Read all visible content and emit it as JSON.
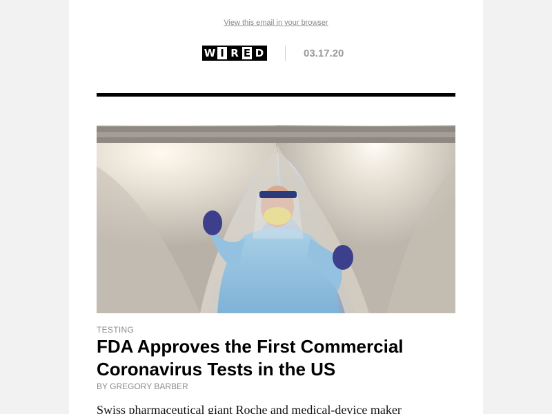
{
  "header": {
    "view_in_browser": "View this email in your browser",
    "logo_letters": [
      "W",
      "I",
      "R",
      "E",
      "D"
    ],
    "date": "03.17.20"
  },
  "article": {
    "kicker": "TESTING",
    "headline": "FDA Approves the First Commercial Coronavirus Tests in the US",
    "byline": "BY GREGORY BARBER",
    "body": "Swiss pharmaceutical giant Roche and medical-device maker"
  },
  "colors": {
    "page_background": "#f2f2f2",
    "content_background": "#ffffff",
    "rule": "#000000",
    "muted_text": "#8c8c8c"
  }
}
